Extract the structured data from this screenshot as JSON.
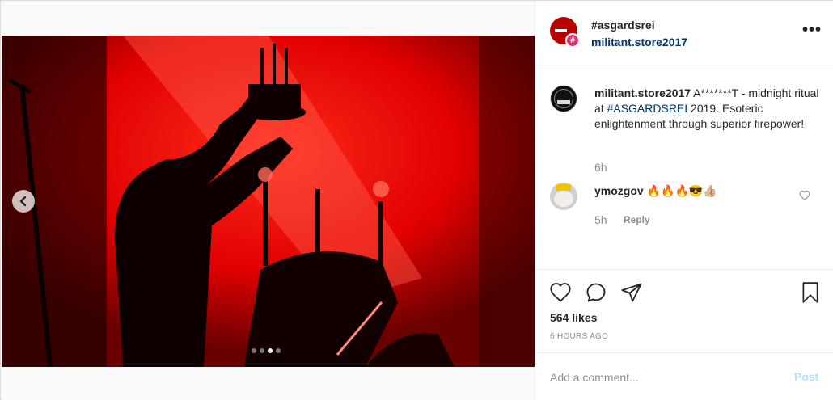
{
  "header": {
    "title": "#asgardsrei",
    "subtitle": "militant.store2017",
    "more_label": "•••"
  },
  "caption": {
    "username": "militant.store2017",
    "text_before": " A*******T - midnight ritual at ",
    "hashtag": "#ASGARDSREI",
    "text_after": " 2019. Esoteric enlightenment through superior firepower!",
    "time": "6h"
  },
  "comment": {
    "username": "ymozgov",
    "text": " 🔥🔥🔥😎👍🏼",
    "time": "5h",
    "reply_label": "Reply"
  },
  "carousel": {
    "slides": 4,
    "active_index": 2
  },
  "footer": {
    "likes": "564 likes",
    "timestamp": "6 HOURS AGO",
    "comment_placeholder": "Add a comment...",
    "post_label": "Post"
  },
  "icons": [
    "chevron-left-icon",
    "more-icon",
    "heart-icon",
    "comment-icon",
    "share-icon",
    "bookmark-icon"
  ],
  "colors": {
    "link": "#003569",
    "muted": "#8e8e8e",
    "post_disabled": "#b2dffc",
    "photo_red": "#d40000"
  }
}
